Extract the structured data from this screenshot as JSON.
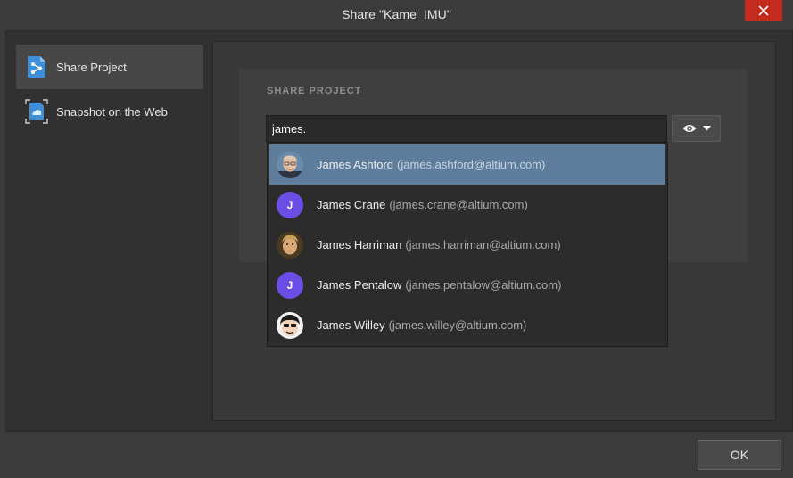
{
  "window": {
    "title": "Share \"Kame_IMU\"",
    "close_icon": "close-icon"
  },
  "nav": {
    "items": [
      {
        "label": "Share Project",
        "icon": "share-project-icon",
        "active": true
      },
      {
        "label": "Snapshot on the Web",
        "icon": "snapshot-web-icon",
        "active": false
      }
    ]
  },
  "share": {
    "section_title": "SHARE PROJECT",
    "search_value": "james.",
    "permission_icon": "eye-icon"
  },
  "suggestions": [
    {
      "name": "James Ashford",
      "email": "(james.ashford@altium.com)",
      "avatar": "photo",
      "highlighted": true
    },
    {
      "name": "James Crane",
      "email": "(james.crane@altium.com)",
      "avatar": "J",
      "highlighted": false
    },
    {
      "name": "James Harriman",
      "email": "(james.harriman@altium.com)",
      "avatar": "photo",
      "highlighted": false
    },
    {
      "name": "James Pentalow",
      "email": "(james.pentalow@altium.com)",
      "avatar": "J",
      "highlighted": false
    },
    {
      "name": "James Willey",
      "email": "(james.willey@altium.com)",
      "avatar": "cartoon",
      "highlighted": false
    }
  ],
  "footer": {
    "ok_label": "OK"
  },
  "colors": {
    "highlight": "#5e7d9c",
    "initial_avatar": "#6b4ee6",
    "close_button": "#c42b1c"
  }
}
